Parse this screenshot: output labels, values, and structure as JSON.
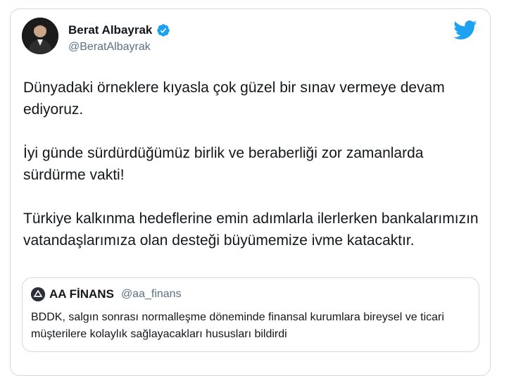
{
  "tweet": {
    "author_name": "Berat Albayrak",
    "author_handle": "@BeratAlbayrak",
    "verified": true,
    "paragraphs": [
      "Dünyadaki örneklere kıyasla çok güzel bir sınav vermeye devam ediyoruz.",
      "İyi günde sürdürdüğümüz birlik ve beraberliği zor zamanlarda sürdürme vakti!",
      "Türkiye kalkınma hedeflerine emin adımlarla ilerlerken bankalarımızın vatandaşlarımıza olan desteği büyümemize ivme katacaktır."
    ]
  },
  "quoted_tweet": {
    "author_name": "AA FİNANS",
    "author_handle": "@aa_finans",
    "text": "BDDK, salgın sonrası normalleşme döneminde finansal kurumlara bireysel ve ticari müşterilere kolaylık sağlayacakları hususları bildirdi"
  },
  "icons": {
    "brand": "twitter-bird-icon",
    "verified": "verified-badge-icon"
  },
  "colors": {
    "twitter_blue": "#1da1f2",
    "text": "#14171a",
    "secondary_text": "#5b7083",
    "border": "#cfd9de"
  }
}
